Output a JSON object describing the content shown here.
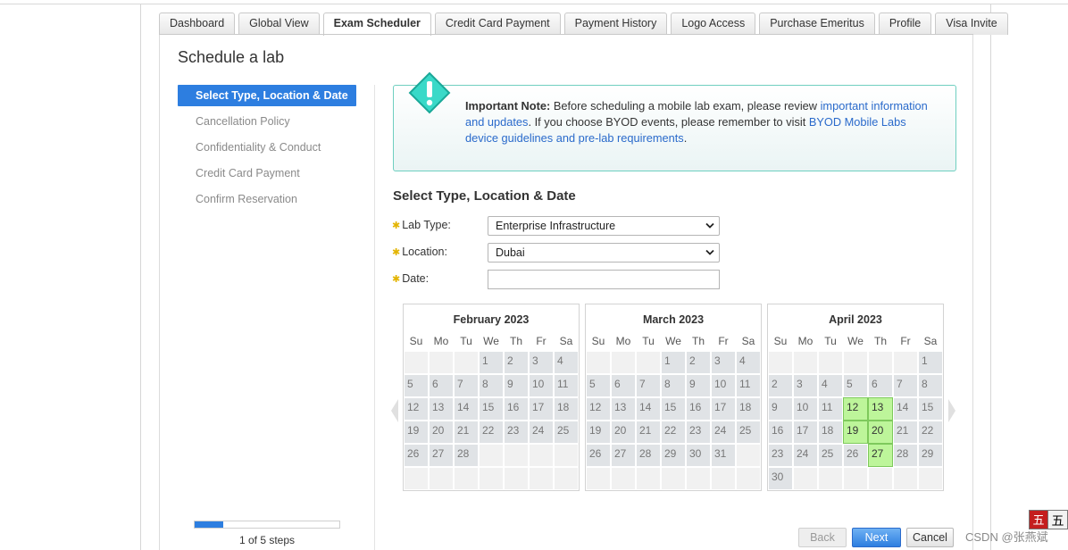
{
  "tabs": [
    {
      "label": "Dashboard"
    },
    {
      "label": "Global View"
    },
    {
      "label": "Exam Scheduler",
      "active": true
    },
    {
      "label": "Credit Card Payment"
    },
    {
      "label": "Payment History"
    },
    {
      "label": "Logo Access"
    },
    {
      "label": "Purchase Emeritus"
    },
    {
      "label": "Profile"
    },
    {
      "label": "Visa Invite"
    }
  ],
  "page_title": "Schedule a lab",
  "steps": [
    {
      "label": "Select Type, Location & Date",
      "active": true
    },
    {
      "label": "Cancellation Policy"
    },
    {
      "label": "Confidentiality & Conduct"
    },
    {
      "label": "Credit Card Payment"
    },
    {
      "label": "Confirm Reservation"
    }
  ],
  "progress": {
    "fraction": 0.2,
    "text": "1 of 5 steps"
  },
  "note": {
    "bold": "Important Note:",
    "text1": " Before scheduling a mobile lab exam, please review ",
    "link1": "important information and updates",
    "text2": ". If you choose BYOD events, please remember to visit ",
    "link2": "BYOD Mobile Labs device guidelines and pre-lab requirements",
    "text3": "."
  },
  "section_title": "Select Type, Location & Date",
  "form": {
    "lab_type_label": "Lab Type:",
    "lab_type_value": "Enterprise Infrastructure",
    "location_label": "Location:",
    "location_value": "Dubai",
    "date_label": "Date:",
    "date_value": ""
  },
  "calendars": [
    {
      "title": "February 2023",
      "start": 3,
      "days": 28,
      "available": []
    },
    {
      "title": "March 2023",
      "start": 3,
      "days": 31,
      "available": []
    },
    {
      "title": "April 2023",
      "start": 6,
      "days": 30,
      "available": [
        12,
        13,
        19,
        20,
        27
      ]
    }
  ],
  "weekdays": [
    "Su",
    "Mo",
    "Tu",
    "We",
    "Th",
    "Fr",
    "Sa"
  ],
  "buttons": {
    "back": "Back",
    "next": "Next",
    "cancel": "Cancel"
  },
  "watermark": "CSDN @张燕斌",
  "corner_widget": {
    "left": "五",
    "right": "五"
  },
  "colors": {
    "accent": "#2d7ee0",
    "available": "#bdf59a",
    "note_border": "#6fcfc0"
  }
}
